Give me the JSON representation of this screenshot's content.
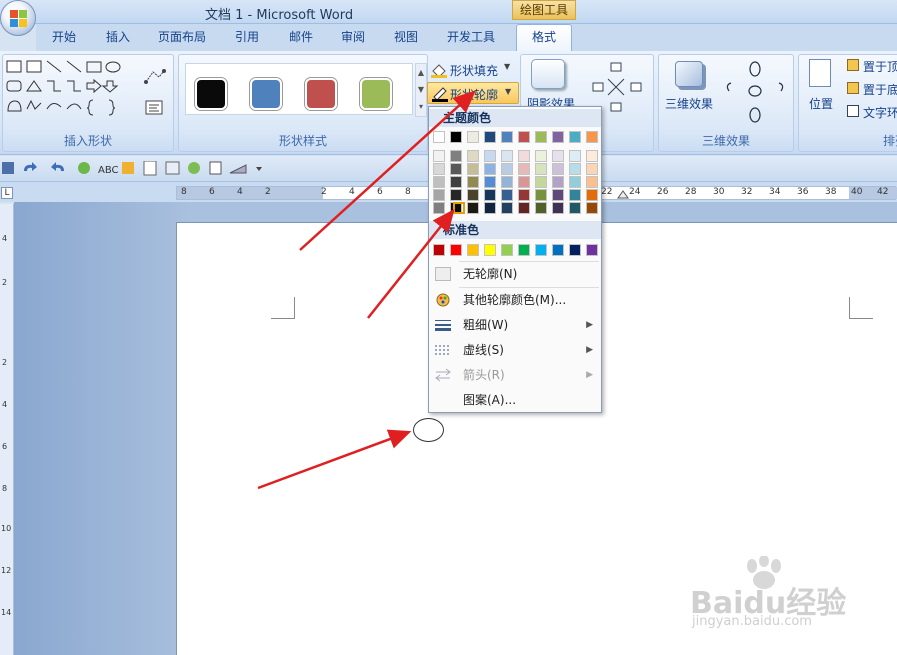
{
  "window": {
    "title": "文档 1 - Microsoft Word",
    "context_tab": "绘图工具"
  },
  "tabs": [
    "开始",
    "插入",
    "页面布局",
    "引用",
    "邮件",
    "审阅",
    "视图",
    "开发工具",
    "格式"
  ],
  "ribbon": {
    "groups": {
      "insert_shapes": "插入形状",
      "shape_styles": "形状样式",
      "shadow_effects": "阴影效果",
      "three_d": "三维效果",
      "three_d_btn": "三维效果",
      "arrange": "排列"
    },
    "shape_fill": "形状填充",
    "shape_outline": "形状轮廓",
    "position": "位置",
    "bring_front": "置于顶",
    "send_back": "置于底",
    "text_wrap": "文字环"
  },
  "style_colors": [
    "#0a0a0a",
    "#4f81bd",
    "#c0504d",
    "#9bbb59"
  ],
  "ruler_labels": [
    "8",
    "6",
    "4",
    "2",
    "2",
    "4",
    "6",
    "8",
    "22",
    "24",
    "26",
    "28",
    "30",
    "32",
    "34",
    "36",
    "38",
    "40",
    "42"
  ],
  "vruler_labels": [
    "4",
    "2",
    "2",
    "4",
    "6",
    "8",
    "10",
    "12",
    "14"
  ],
  "menu": {
    "theme_title": "主题颜色",
    "standard_title": "标准色",
    "theme_top": [
      "#ffffff",
      "#000000",
      "#eeece1",
      "#1f497d",
      "#4f81bd",
      "#c0504d",
      "#9bbb59",
      "#8064a2",
      "#4bacc6",
      "#f79646"
    ],
    "theme_shades": [
      [
        "#f2f2f2",
        "#d8d8d8",
        "#bfbfbf",
        "#a5a5a5",
        "#7f7f7f"
      ],
      [
        "#7f7f7f",
        "#595959",
        "#3f3f3f",
        "#262626",
        "#0c0c0c"
      ],
      [
        "#ddd9c3",
        "#c4bd97",
        "#938953",
        "#494429",
        "#1d1b10"
      ],
      [
        "#c6d9f0",
        "#8db3e2",
        "#548dd4",
        "#17365d",
        "#0f243e"
      ],
      [
        "#dbe5f1",
        "#b8cce4",
        "#95b3d7",
        "#366092",
        "#244061"
      ],
      [
        "#f2dcdb",
        "#e5b9b7",
        "#d99694",
        "#953734",
        "#632423"
      ],
      [
        "#ebf1dd",
        "#d7e3bc",
        "#c3d69b",
        "#76923c",
        "#4f6128"
      ],
      [
        "#e5e0ec",
        "#ccc1d9",
        "#b2a2c7",
        "#5f497a",
        "#3f3151"
      ],
      [
        "#dbeef3",
        "#b7dde8",
        "#92cddc",
        "#31859b",
        "#205867"
      ],
      [
        "#fdeada",
        "#fbd5b5",
        "#fac08f",
        "#e36c09",
        "#974806"
      ]
    ],
    "standard": [
      "#c00000",
      "#ff0000",
      "#ffc000",
      "#ffff00",
      "#92d050",
      "#00b050",
      "#00b0f0",
      "#0070c0",
      "#002060",
      "#7030a0"
    ],
    "no_outline": "无轮廓(N)",
    "more_colors": "其他轮廓颜色(M)...",
    "weight": "粗细(W)",
    "dashes": "虚线(S)",
    "arrows": "箭头(R)",
    "pattern": "图案(A)..."
  },
  "watermark": {
    "brand": "Baidu经验",
    "url": "jingyan.baidu.com"
  },
  "annotation_color": "#e02020"
}
